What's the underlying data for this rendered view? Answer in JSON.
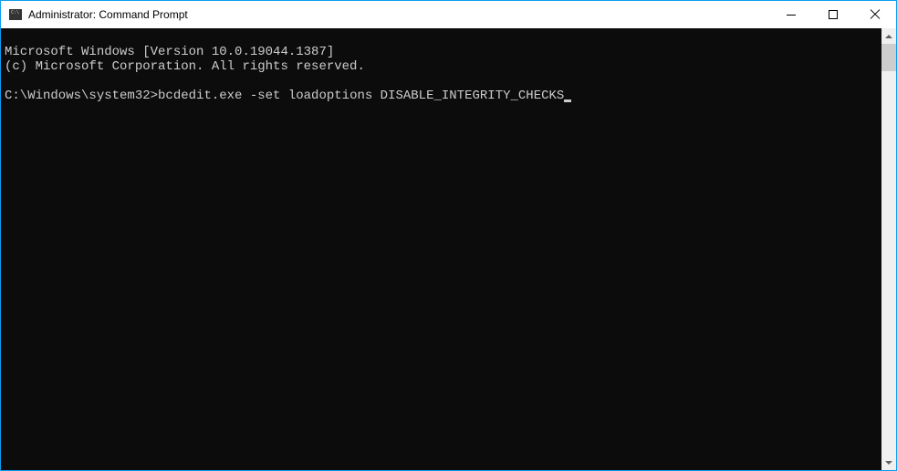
{
  "window": {
    "title": "Administrator: Command Prompt"
  },
  "terminal": {
    "line1": "Microsoft Windows [Version 10.0.19044.1387]",
    "line2": "(c) Microsoft Corporation. All rights reserved.",
    "blank": "",
    "prompt": "C:\\Windows\\system32>",
    "command": "bcdedit.exe -set loadoptions DISABLE_INTEGRITY_CHECKS"
  }
}
